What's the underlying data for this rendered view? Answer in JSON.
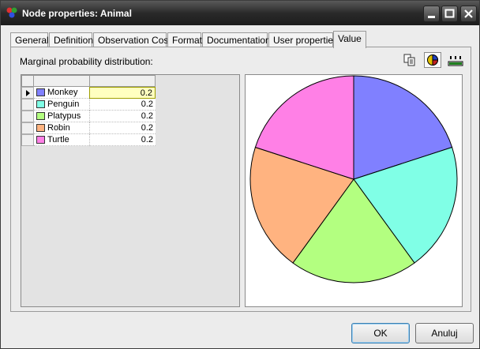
{
  "window": {
    "title": "Node properties: Animal",
    "icon": "app-network-icon"
  },
  "tabs": [
    {
      "label": "General"
    },
    {
      "label": "Definition"
    },
    {
      "label": "Observation Cost"
    },
    {
      "label": "Format"
    },
    {
      "label": "Documentation"
    },
    {
      "label": "User properties"
    },
    {
      "label": "Value",
      "active": true
    }
  ],
  "panel": {
    "label": "Marginal probability distribution:",
    "tools": [
      "copy-icon",
      "pie-chart-icon",
      "bar-chart-icon"
    ]
  },
  "rows": [
    {
      "name": "Monkey",
      "value": "0.2",
      "color": "#8080ff",
      "selected": true
    },
    {
      "name": "Penguin",
      "value": "0.2",
      "color": "#80ffe6"
    },
    {
      "name": "Platypus",
      "value": "0.2",
      "color": "#b3ff80"
    },
    {
      "name": "Robin",
      "value": "0.2",
      "color": "#ffb380"
    },
    {
      "name": "Turtle",
      "value": "0.2",
      "color": "#ff80e6"
    }
  ],
  "chart_data": {
    "type": "pie",
    "categories": [
      "Monkey",
      "Penguin",
      "Platypus",
      "Robin",
      "Turtle"
    ],
    "values": [
      0.2,
      0.2,
      0.2,
      0.2,
      0.2
    ],
    "colors": [
      "#8080ff",
      "#80ffe6",
      "#b3ff80",
      "#ffb380",
      "#ff80e6"
    ]
  },
  "buttons": {
    "ok": "OK",
    "cancel": "Anuluj"
  }
}
